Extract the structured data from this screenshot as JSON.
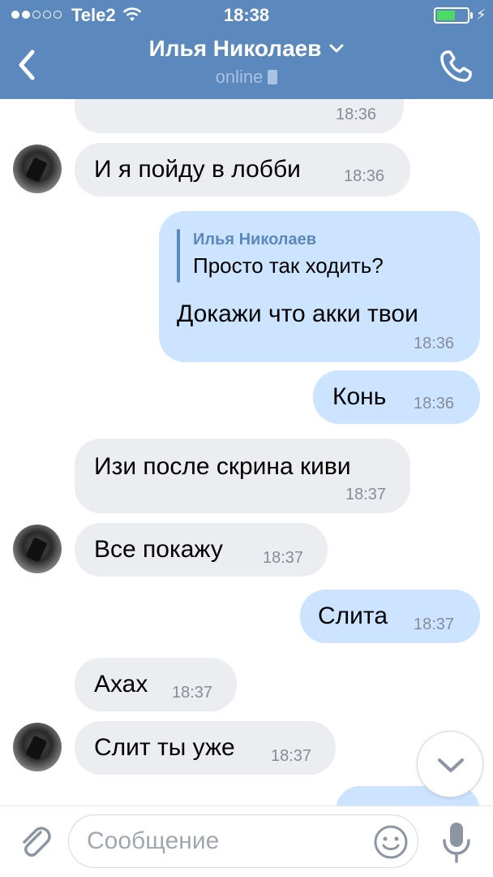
{
  "status_bar": {
    "carrier": "Tele2",
    "time": "18:38",
    "signal_bars_filled": 2,
    "signal_bars_total": 5,
    "battery_level": 0.6,
    "battery_color": "#4cd964"
  },
  "header": {
    "contact_name": "Илья Николаев",
    "status": "online",
    "background_color": "#5b88bd"
  },
  "messages": [
    {
      "direction": "in",
      "text": "",
      "time": "18:36"
    },
    {
      "direction": "in",
      "text": "И я пойду в лобби",
      "time": "18:36"
    },
    {
      "direction": "out",
      "reply_author": "Илья Николаев",
      "reply_text": "Просто так ходить?",
      "text": "Докажи что акки твои",
      "time": "18:36"
    },
    {
      "direction": "out",
      "text": "Конь",
      "time": "18:36"
    },
    {
      "direction": "in",
      "text": "Изи после скрина киви",
      "time": "18:37"
    },
    {
      "direction": "in",
      "text": "Все покажу",
      "time": "18:37"
    },
    {
      "direction": "out",
      "text": "Слита",
      "time": "18:37"
    },
    {
      "direction": "in",
      "text": "Ахах",
      "time": "18:37"
    },
    {
      "direction": "in",
      "text": "Слит ты уже",
      "time": "18:37"
    }
  ],
  "composer": {
    "placeholder": "Сообщение"
  },
  "icons": {
    "back": "chevron-left-icon",
    "title_dropdown": "chevron-down-icon",
    "call": "phone-icon",
    "scroll": "chevron-down-icon",
    "attach": "paperclip-icon",
    "emoji": "smile-icon",
    "voice": "microphone-icon"
  },
  "colors": {
    "incoming_bubble": "#ebedf0",
    "outgoing_bubble": "#cce4ff",
    "accent": "#5b88bd",
    "timestamp": "#848d99"
  }
}
